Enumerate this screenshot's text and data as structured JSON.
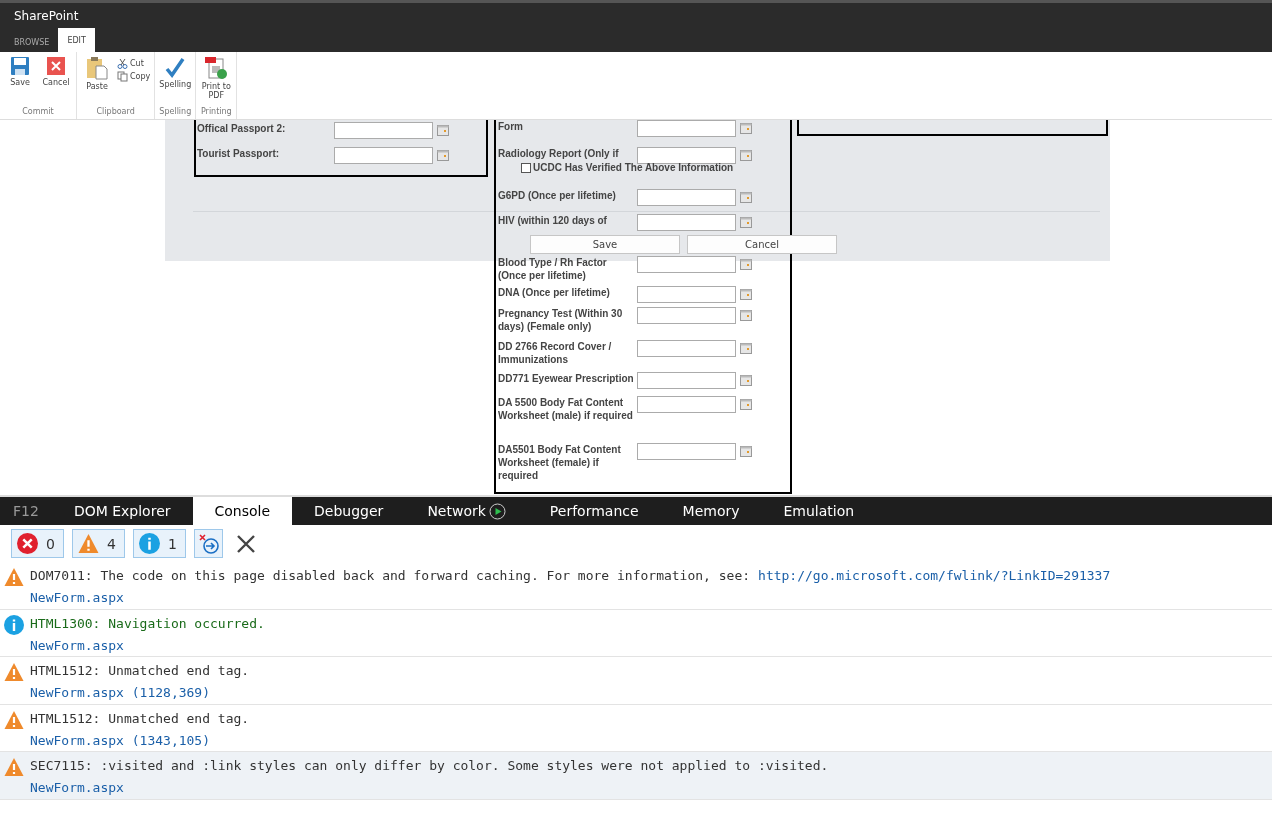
{
  "window": {
    "title": "SharePoint"
  },
  "ribbon_tabs": [
    {
      "label": "BROWSE",
      "selected": false
    },
    {
      "label": "EDIT",
      "selected": true
    }
  ],
  "ribbon_groups": [
    {
      "label": "Commit",
      "buttons": [
        {
          "kind": "save",
          "label": "Save"
        },
        {
          "kind": "cancel",
          "label": "Cancel"
        }
      ]
    },
    {
      "label": "Clipboard",
      "buttons": [
        {
          "kind": "paste",
          "label": "Paste"
        }
      ],
      "small_buttons": [
        {
          "kind": "cut",
          "label": "Cut"
        },
        {
          "kind": "copy",
          "label": "Copy"
        }
      ]
    },
    {
      "label": "Spelling",
      "buttons": [
        {
          "kind": "spelling",
          "label": "Spelling"
        }
      ]
    },
    {
      "label": "Printing",
      "buttons": [
        {
          "kind": "pdf",
          "label": "Print to PDF"
        }
      ]
    }
  ],
  "form": {
    "left_fields": [
      {
        "label": "Offical Passport 2:"
      },
      {
        "label": "Tourist Passport:"
      }
    ],
    "middle_fields": [
      {
        "label": "Form"
      },
      {
        "label": "Radiology Report (Only if"
      },
      {
        "label": "G6PD (Once per lifetime)"
      },
      {
        "label": "HIV (within 120 days of"
      },
      {
        "label": "Blood Type / Rh Factor (Once per lifetime)"
      },
      {
        "label": "DNA (Once per lifetime)"
      },
      {
        "label": "Pregnancy Test (Within 30 days) (Female only)"
      },
      {
        "label": "DD 2766 Record Cover / Immunizations"
      },
      {
        "label": "DD771 Eyewear Prescription"
      },
      {
        "label": "DA 5500 Body Fat Content Worksheet (male) if required"
      },
      {
        "label": "DA5501 Body Fat Content Worksheet (female) if required"
      }
    ],
    "verify_checkbox": {
      "label": "UCDC Has Verified The Above Information",
      "checked": false
    },
    "buttons": [
      "Save",
      "Cancel"
    ]
  },
  "devtools": {
    "tabs": [
      {
        "label": "F12",
        "selected": false
      },
      {
        "label": "DOM Explorer",
        "selected": false
      },
      {
        "label": "Console",
        "selected": true
      },
      {
        "label": "Debugger",
        "selected": false
      },
      {
        "label": "Network",
        "selected": false
      },
      {
        "label": "Performance",
        "selected": false
      },
      {
        "label": "Memory",
        "selected": false
      },
      {
        "label": "Emulation",
        "selected": false
      }
    ],
    "filters": [
      {
        "kind": "error",
        "count": "0"
      },
      {
        "kind": "warning",
        "count": "4"
      },
      {
        "kind": "info",
        "count": "1"
      }
    ],
    "messages": [
      {
        "kind": "warning",
        "text": "DOM7011: The code on this page disabled back and forward caching. For more information, see:",
        "link": "http://go.microsoft.com/fwlink/?LinkID=291337",
        "source": "NewForm.aspx",
        "selected": false
      },
      {
        "kind": "info",
        "text": "HTML1300: Navigation occurred.",
        "source": "NewForm.aspx",
        "selected": false
      },
      {
        "kind": "warning",
        "text": "HTML1512: Unmatched end tag.",
        "source": "NewForm.aspx (1128,369)",
        "selected": false
      },
      {
        "kind": "warning",
        "text": "HTML1512: Unmatched end tag.",
        "source": "NewForm.aspx (1343,105)",
        "selected": false
      },
      {
        "kind": "warning",
        "text": "SEC7115: :visited and :link styles can only differ by color. Some styles were not applied to :visited.",
        "source": "NewForm.aspx",
        "selected": true
      }
    ]
  }
}
